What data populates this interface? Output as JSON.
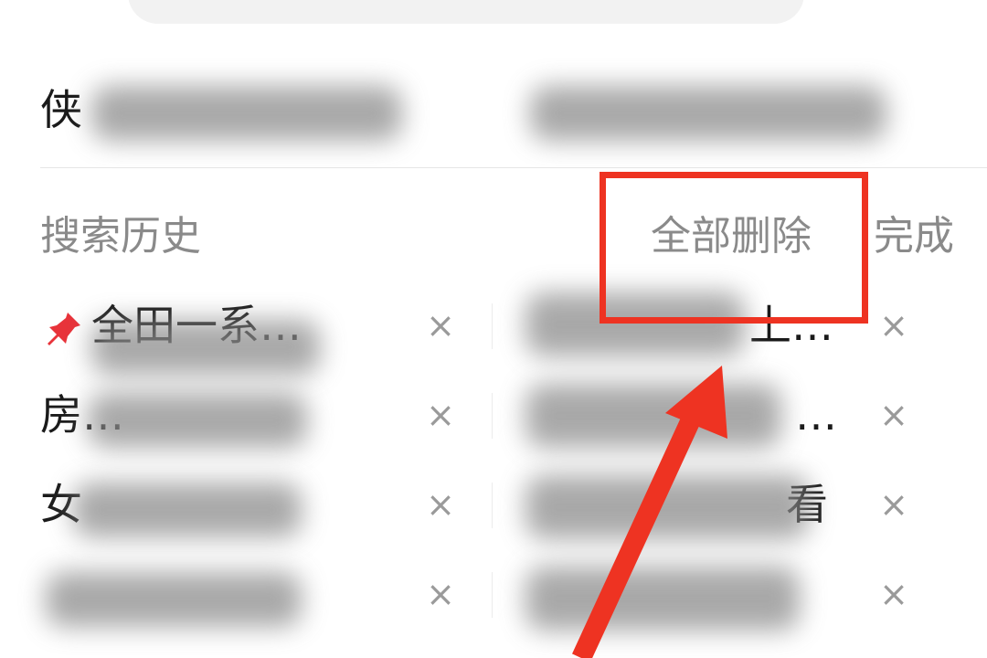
{
  "search_bar": {
    "value": ""
  },
  "suggestion_row": {
    "left_visible_char": "侠"
  },
  "history": {
    "title": "搜索历史",
    "delete_all_label": "全部删除",
    "done_label": "完成",
    "close_glyph": "×",
    "rows": [
      {
        "left_text": "全田一系…",
        "left_pinned": true,
        "right_text": "上…"
      },
      {
        "left_text": "房…",
        "left_pinned": false,
        "right_text": "…"
      },
      {
        "left_text": "女",
        "left_pinned": false,
        "right_text": "看"
      },
      {
        "left_text": "",
        "left_pinned": false,
        "right_text": ""
      }
    ]
  },
  "annotation": {
    "box_color": "#ee3322",
    "arrow_color": "#ee3322"
  },
  "icons": {
    "pin": "pin-icon",
    "close": "close-icon"
  }
}
